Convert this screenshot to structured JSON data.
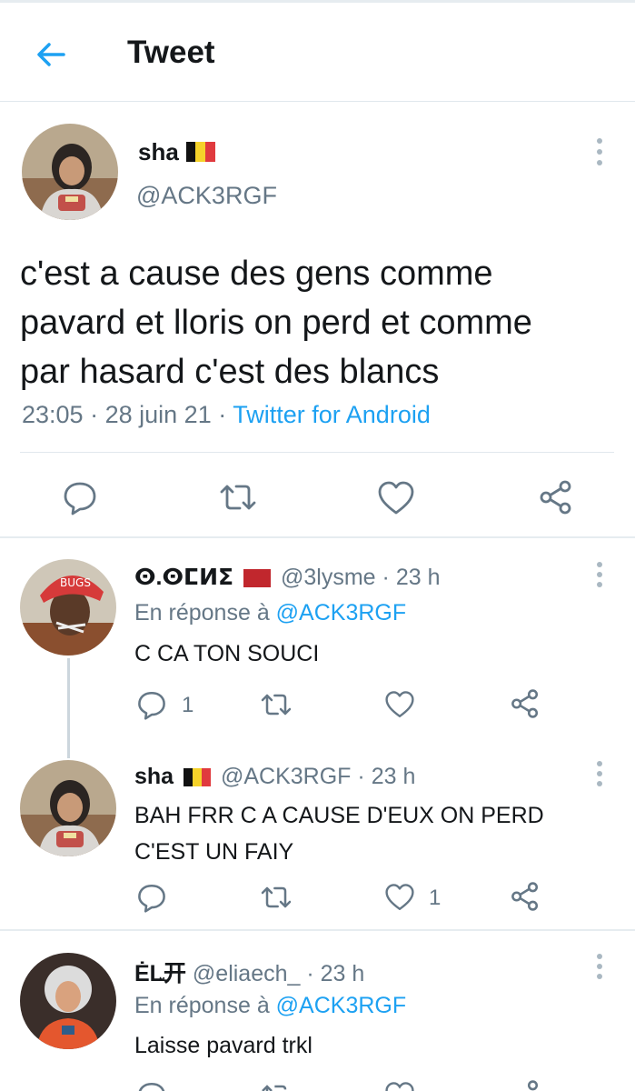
{
  "header": {
    "title": "Tweet",
    "back_icon": "arrow-left-icon"
  },
  "main_tweet": {
    "name": "sha",
    "flag": "belgium-flag",
    "handle": "@ACK3RGF",
    "text_lines": [
      "c'est a cause des gens comme",
      "pavard et lloris on perd et comme",
      "par hasard c'est des blancs"
    ],
    "time": "23:05",
    "date": "28 juin 21",
    "client": "Twitter for Android",
    "dot": "·"
  },
  "replies": [
    {
      "name": "ⵙ.ⵙⵎⵍⵉ",
      "handle": "@3lysme",
      "time": "23 h",
      "reply_to_label": "En réponse à",
      "reply_to": "@ACK3RGF",
      "text_lines": [
        "C CA TON SOUCI"
      ],
      "reply_count": "1",
      "like_count": ""
    },
    {
      "name": "sha",
      "handle": "@ACK3RGF",
      "time": "23 h",
      "text_lines": [
        "BAH FRR C A CAUSE D'EUX ON PERD",
        "C'EST UN FAIY"
      ],
      "reply_count": "",
      "like_count": "1"
    },
    {
      "name": "ĖL꜡开",
      "handle": "@eliaech_",
      "time": "23 h",
      "reply_to_label": "En réponse à",
      "reply_to": "@ACK3RGF",
      "text_lines": [
        "Laisse pavard trkl"
      ]
    }
  ],
  "colors": {
    "accent": "#1da1f2",
    "muted": "#657786",
    "divider": "#e1e8ed"
  }
}
